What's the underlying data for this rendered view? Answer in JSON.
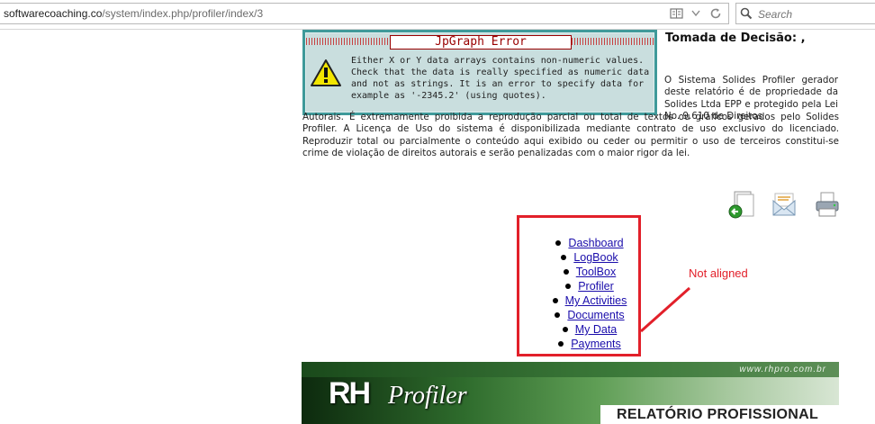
{
  "browser": {
    "url_host": "softwarecoaching.co",
    "url_path": "/system/index.php/profiler/index/3",
    "search_placeholder": "Search"
  },
  "error_box": {
    "title": "JpGraph Error",
    "message": "Either X or Y data arrays contains non-numeric values.\nCheck that the data is really specified as numeric data\nand not as strings. It is an error to specify data for\nexample as '-2345.2' (using quotes)."
  },
  "report": {
    "heading": "Tomada de Decisão: ,",
    "paragraph_right": "O Sistema Solides Profiler gerador deste relatório é de propriedade da Solides Ltda EPP e protegido pela Lei No. 9.610 de Direitos",
    "paragraph_full": "Autorais. É extremamente proibida a reprodução parcial ou total de textos ou gráficos gerados pelo Solides Profiler. A Licença de Uso do sistema é disponibilizada mediante contrato de uso exclusivo do licenciado. Reproduzir total ou parcialmente o conteúdo aqui exibido ou ceder ou permitir o uso de terceiros constitui-se crime de violação de direitos autorais e serão penalizadas com o maior rigor da lei."
  },
  "actions": {
    "icons": [
      "back-icon",
      "email-icon",
      "print-icon"
    ]
  },
  "nav": {
    "items": [
      "Dashboard",
      "LogBook",
      "ToolBox",
      "Profiler",
      "My Activities",
      "Documents",
      "My Data",
      "Payments"
    ]
  },
  "annotation": {
    "text": "Not aligned",
    "color": "#e2202a"
  },
  "banner": {
    "url": "www.rhpro.com.br",
    "logo_rh": "RH",
    "logo_profiler": "Profiler",
    "subtitle": "RELATÓRIO PROFISSIONAL"
  },
  "colors": {
    "link": "#1a0dab",
    "error_frame": "#3f9a9a",
    "error_title": "#990000"
  }
}
